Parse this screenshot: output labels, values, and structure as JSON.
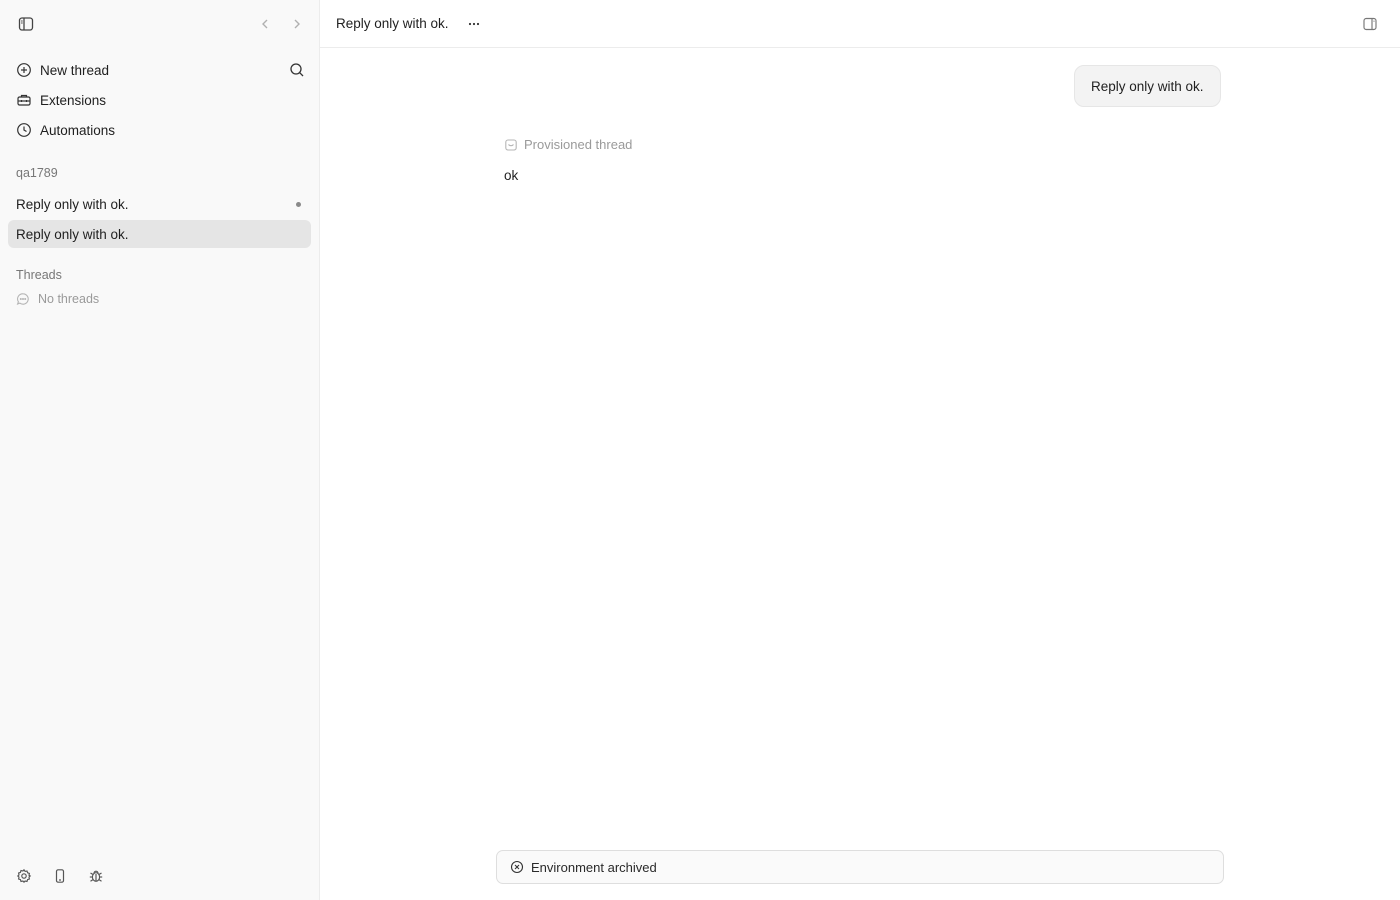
{
  "sidebar": {
    "nav": [
      {
        "label": "New thread",
        "icon": "plus-circle-icon"
      },
      {
        "label": "Extensions",
        "icon": "toolbox-icon"
      },
      {
        "label": "Automations",
        "icon": "clock-icon"
      }
    ],
    "project": {
      "name": "qa1789",
      "threads": [
        {
          "label": "Reply only with ok.",
          "unread": true
        },
        {
          "label": "Reply only with ok.",
          "active": true
        }
      ]
    },
    "threads_section": {
      "label": "Threads",
      "empty_text": "No threads"
    },
    "footer_icons": [
      "gear-icon",
      "phone-icon",
      "bug-icon"
    ]
  },
  "header": {
    "title": "Reply only with ok."
  },
  "conversation": {
    "user_message": "Reply only with ok.",
    "assistant_meta": "Provisioned thread",
    "assistant_reply": "ok"
  },
  "status_bar": {
    "label": "Environment archived",
    "icon": "x-circle-icon"
  }
}
